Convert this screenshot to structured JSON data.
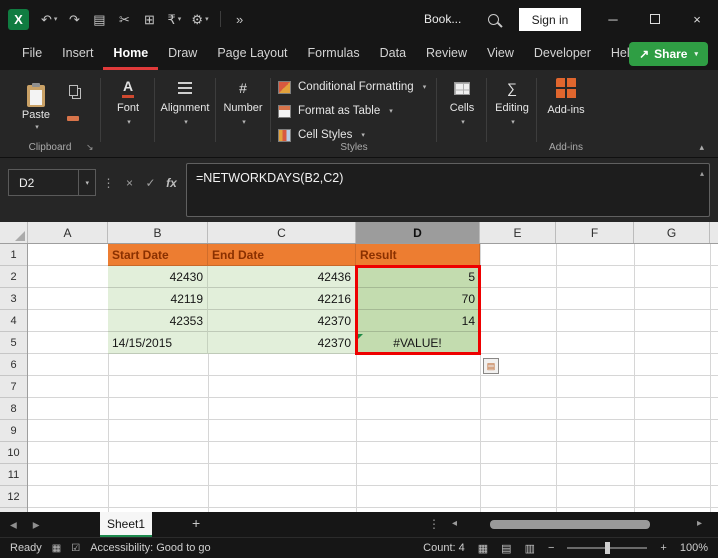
{
  "icons": {
    "caret": "▾",
    "undo": "↶",
    "redo": "↷",
    "clipboard": "▤",
    "scissors": "✂",
    "workbook": "⊞",
    "currency": "₹",
    "gear": "⚙",
    "overflow": "»",
    "minimize": "─",
    "close": "×",
    "share_arrow": "↗",
    "dialog_launcher": "↘",
    "dots_vertical": "⋮",
    "cancel": "×",
    "check": "✓",
    "fx": "fx",
    "collapse_up": "▴",
    "font_letter": "A",
    "number_sign": "#",
    "sum": "∑",
    "tab_left": "◂",
    "tab_right": "▸",
    "add_sheet": "+",
    "scroll_left": "◂",
    "scroll_right": "▸",
    "status_grid": "▦",
    "accessibility_check": "☑",
    "view_normal": "▦",
    "view_layout": "▤",
    "view_break": "▥",
    "zoom_minus": "−",
    "zoom_plus": "+",
    "error_options": "▤"
  },
  "titlebar": {
    "logo_letter": "X",
    "document_name": "Book...",
    "sign_in_label": "Sign in"
  },
  "menubar": {
    "tabs": [
      "File",
      "Insert",
      "Home",
      "Draw",
      "Page Layout",
      "Formulas",
      "Data",
      "Review",
      "View",
      "Developer",
      "Help"
    ],
    "active_tab": "Home",
    "share_label": "Share"
  },
  "ribbon": {
    "paste_label": "Paste",
    "clipboard_group_label": "Clipboard",
    "font_label": "Font",
    "alignment_label": "Alignment",
    "number_label": "Number",
    "conditional_formatting_label": "Conditional Formatting",
    "format_as_table_label": "Format as Table",
    "cell_styles_label": "Cell Styles",
    "styles_group_label": "Styles",
    "cells_label": "Cells",
    "editing_label": "Editing",
    "addins_label": "Add-ins",
    "addins_group_label": "Add-ins"
  },
  "formula_bar": {
    "name_box_value": "D2",
    "formula": "=NETWORKDAYS(B2,C2)"
  },
  "grid": {
    "column_headers": [
      "A",
      "B",
      "C",
      "D",
      "E",
      "F",
      "G"
    ],
    "row_headers": [
      "1",
      "2",
      "3",
      "4",
      "5",
      "6",
      "7",
      "8",
      "9",
      "10",
      "11",
      "12"
    ],
    "selected_column": "D",
    "selected_cell": "D2",
    "table": {
      "headers": {
        "start": "Start Date",
        "end": "End Date",
        "result": "Result"
      },
      "rows": [
        {
          "start": "42430",
          "end": "42436",
          "result": "5"
        },
        {
          "start": "42119",
          "end": "42216",
          "result": "70"
        },
        {
          "start": "42353",
          "end": "42370",
          "result": "14"
        },
        {
          "start": "14/15/2015",
          "end": "42370",
          "result": "#VALUE!"
        }
      ]
    },
    "colors": {
      "header_fill": "#ED7D31",
      "header_text": "#8A3000",
      "input_fill": "#E2EFDA",
      "result_fill": "#C3DCAF",
      "highlight_border": "#EE0000",
      "error_indicator": "#1F8A46"
    }
  },
  "sheet_bar": {
    "active_sheet": "Sheet1"
  },
  "status_bar": {
    "mode": "Ready",
    "accessibility": "Accessibility: Good to go",
    "count": "Count: 4",
    "zoom": "100%"
  }
}
